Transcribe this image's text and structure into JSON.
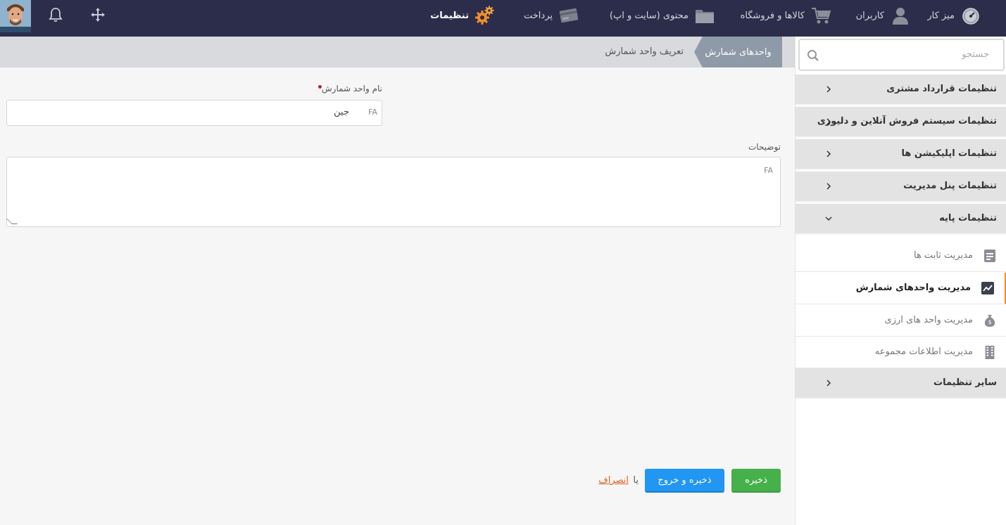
{
  "topbar": {
    "nav": [
      {
        "label": "میز کار",
        "icon": "dashboard-gauge-icon"
      },
      {
        "label": "کاربران",
        "icon": "user-icon"
      },
      {
        "label": "کالاها و فروشگاه",
        "icon": "cart-icon"
      },
      {
        "label": "محتوی (سایت و اپ)",
        "icon": "folder-icon"
      },
      {
        "label": "پرداخت",
        "icon": "credit-card-icon"
      },
      {
        "label": "تنظیمات",
        "icon": "gears-icon",
        "active": true
      }
    ],
    "tools": [
      "move-crosshair-icon",
      "bell-icon"
    ],
    "avatar": "user-avatar"
  },
  "breadcrumb": {
    "parent": "واحدهای شمارش",
    "current": "تعریف واحد شمارش"
  },
  "form": {
    "name_label": "نام واحد شمارش",
    "name_value": "جین",
    "name_lang": "FA",
    "desc_label": "توضیحات",
    "desc_value": "",
    "desc_lang": "FA",
    "save_label": "ذخیره",
    "save_exit_label": "ذخیره و خروج",
    "or_text": "یا",
    "cancel_label": "انصراف"
  },
  "sidebar": {
    "search_placeholder": "جستجو",
    "groups": [
      {
        "label": "تنظیمات قرارداد مشتری",
        "expanded": false
      },
      {
        "label": "تنظیمات سیستم فروش آنلاین و دلیوری",
        "expanded": false
      },
      {
        "label": "تنظیمات اپلیکیشن ها",
        "expanded": false
      },
      {
        "label": "تنظیمات پنل مدیریت",
        "expanded": false
      },
      {
        "label": "تنظیمات پایه",
        "expanded": true
      },
      {
        "label": "سایر تنظیمات",
        "expanded": false
      }
    ],
    "sub_items": [
      {
        "label": "مدیریت ثابت ها",
        "icon": "form-icon",
        "selected": false
      },
      {
        "label": "مدیریت واحدهای شمارش",
        "icon": "chart-line-icon",
        "selected": true
      },
      {
        "label": "مدیریت واحد های ارزی",
        "icon": "money-bag-icon",
        "selected": false
      },
      {
        "label": "مدیریت اطلاعات مجموعه",
        "icon": "building-icon",
        "selected": false
      }
    ]
  },
  "colors": {
    "topbar": "#2b2d4a",
    "accent": "#f28c2b",
    "save": "#46b04a",
    "save_exit": "#2196f3",
    "required": "#b3262c",
    "cancel": "#e0601f"
  }
}
